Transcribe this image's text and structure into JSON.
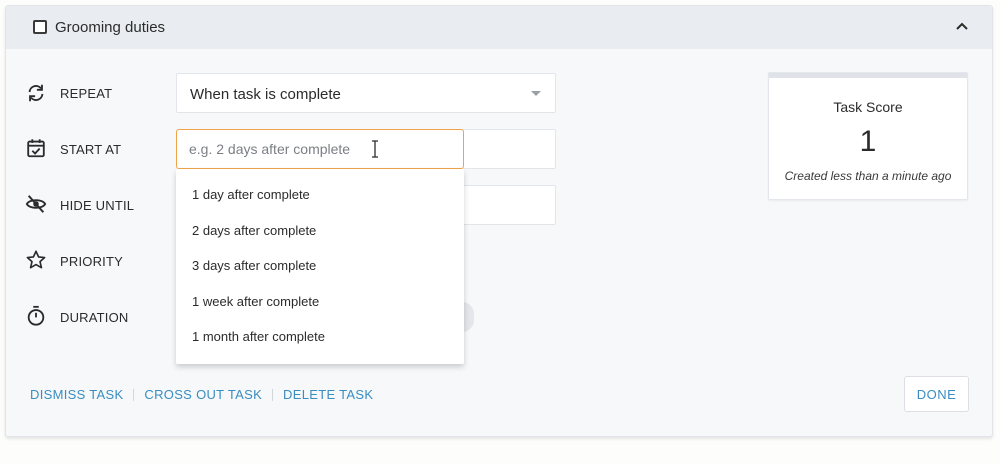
{
  "header": {
    "title": "Grooming duties",
    "checkbox_checked": false
  },
  "fields": {
    "repeat": {
      "label": "REPEAT",
      "icon": "sync-icon"
    },
    "start_at": {
      "label": "START AT",
      "icon": "calendar-check-icon"
    },
    "hide_until": {
      "label": "HIDE UNTIL",
      "icon": "eye-off-icon"
    },
    "priority": {
      "label": "PRIORITY",
      "icon": "star-icon"
    },
    "duration": {
      "label": "DURATION",
      "icon": "timer-icon"
    }
  },
  "repeat_select": {
    "value": "When task is complete"
  },
  "start_input": {
    "placeholder": "e.g. 2 days after complete",
    "value": ""
  },
  "dropdown": {
    "options": [
      "1 day after complete",
      "2 days after complete",
      "3 days after complete",
      "1 week after complete",
      "1 month after complete"
    ]
  },
  "score": {
    "title": "Task Score",
    "value": "1",
    "meta": "Created less than a minute ago"
  },
  "footer": {
    "dismiss": "DISMISS TASK",
    "cross_out": "CROSS OUT TASK",
    "delete": "DELETE TASK",
    "done": "DONE"
  },
  "colors": {
    "accent": "#3a8dc1",
    "focus_border": "#f0a44a",
    "header_bg": "#e9edf2"
  }
}
